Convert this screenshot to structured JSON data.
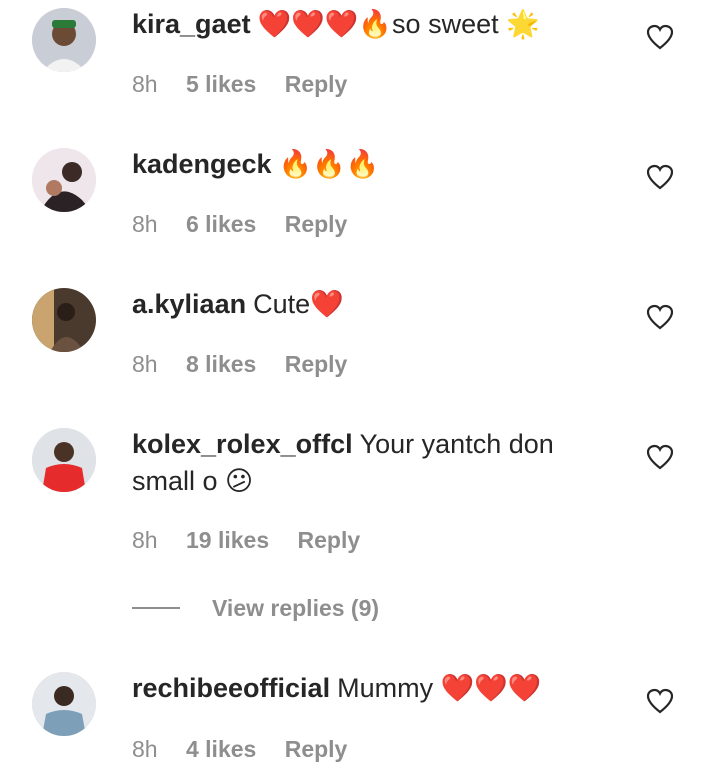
{
  "comments": [
    {
      "username": "kira_gaet",
      "text": "❤️❤️❤️🔥so sweet 🌟",
      "time": "8h",
      "likes": "5 likes",
      "reply": "Reply"
    },
    {
      "username": "kadengeck",
      "text": "🔥🔥🔥",
      "time": "8h",
      "likes": "6 likes",
      "reply": "Reply"
    },
    {
      "username": "a.kyliaan",
      "text": "Cute❤️",
      "time": "8h",
      "likes": "8 likes",
      "reply": "Reply"
    },
    {
      "username": "kolex_rolex_offcl",
      "text": "Your yantch don small o 😕",
      "time": "8h",
      "likes": "19 likes",
      "reply": "Reply"
    },
    {
      "username": "rechibeeofficial",
      "text": "Mummy ❤️❤️❤️",
      "time": "8h",
      "likes": "4 likes",
      "reply": "Reply"
    }
  ],
  "view_replies": "View replies (9)",
  "colors": {
    "text": "#262626",
    "muted": "#8e8e8e",
    "heart": "#e0245e"
  },
  "icons": {
    "like": "heart-outline-icon"
  }
}
